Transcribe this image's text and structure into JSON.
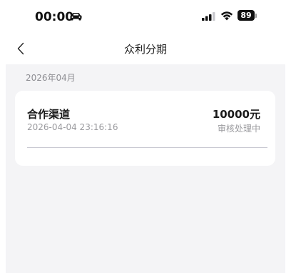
{
  "status_bar": {
    "time": "00:00",
    "battery_level": "89",
    "icons": [
      "car-icon",
      "cellular-signal-icon",
      "wifi-icon",
      "battery-icon"
    ]
  },
  "nav": {
    "back_icon": "chevron-left-icon",
    "title": "众利分期"
  },
  "records": {
    "month_label": "2026年04月",
    "items": [
      {
        "title": "合作渠道",
        "datetime": "2026-04-04 23:16:16",
        "amount": "10000元",
        "status": "审核处理中"
      }
    ]
  },
  "colors": {
    "background": "#f4f4f6",
    "card": "#ffffff",
    "primary_text": "#1a1a1a",
    "secondary_text": "#9a9a9e"
  }
}
